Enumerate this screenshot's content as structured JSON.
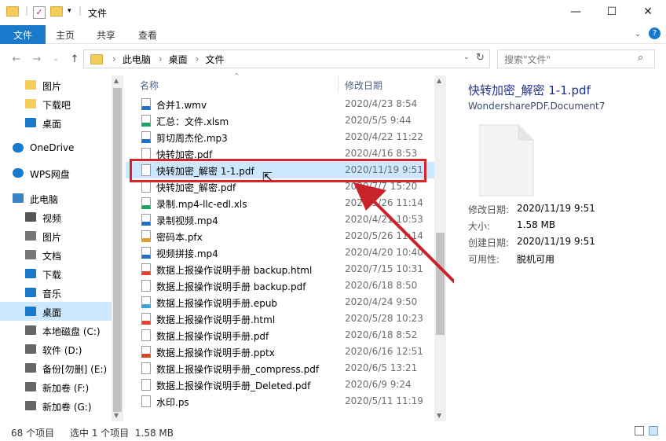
{
  "window": {
    "title": "文件",
    "minimize": "—",
    "maximize": "☐",
    "close": "✕",
    "help": "?"
  },
  "ribbon": {
    "tabs": [
      "文件",
      "主页",
      "共享",
      "查看"
    ]
  },
  "address": {
    "segments": [
      "此电脑",
      "桌面",
      "文件"
    ],
    "sep": "›"
  },
  "search": {
    "placeholder": "搜索\"文件\""
  },
  "nav": {
    "items": [
      {
        "label": "图片",
        "icon": "folder-icon"
      },
      {
        "label": "下载吧",
        "icon": "folder-icon"
      },
      {
        "label": "桌面",
        "icon": "desktop-icon"
      },
      {
        "label": "OneDrive",
        "icon": "cloud-icon"
      },
      {
        "label": "WPS网盘",
        "icon": "cloud-icon"
      },
      {
        "label": "此电脑",
        "icon": "computer-icon"
      },
      {
        "label": "视频",
        "icon": "video-folder-icon"
      },
      {
        "label": "图片",
        "icon": "pictures-folder-icon"
      },
      {
        "label": "文档",
        "icon": "documents-folder-icon"
      },
      {
        "label": "下载",
        "icon": "download-icon"
      },
      {
        "label": "音乐",
        "icon": "music-icon"
      },
      {
        "label": "桌面",
        "icon": "desktop-icon"
      },
      {
        "label": "本地磁盘 (C:)",
        "icon": "drive-icon"
      },
      {
        "label": "软件 (D:)",
        "icon": "drive-icon"
      },
      {
        "label": "备份[勿删] (E:)",
        "icon": "drive-icon"
      },
      {
        "label": "新加卷 (F:)",
        "icon": "drive-icon"
      },
      {
        "label": "新加卷 (G:)",
        "icon": "drive-icon"
      }
    ]
  },
  "list": {
    "col_name": "名称",
    "col_date": "修改日期",
    "files": [
      {
        "name": "合并1.wmv",
        "date": "2020/4/23 8:54",
        "icon": "video-file-icon"
      },
      {
        "name": "汇总：文件.xlsm",
        "date": "2020/5/5 9:44",
        "icon": "excel-file-icon"
      },
      {
        "name": "剪切周杰伦.mp3",
        "date": "2020/4/22 11:22",
        "icon": "audio-file-icon"
      },
      {
        "name": "快转加密.pdf",
        "date": "2020/4/16 8:53",
        "icon": "pdf-file-icon"
      },
      {
        "name": "快转加密_解密 1-1.pdf",
        "date": "2020/11/19 9:51",
        "icon": "pdf-file-icon"
      },
      {
        "name": "快转加密_解密.pdf",
        "date": "2020/7/7 15:20",
        "icon": "pdf-file-icon"
      },
      {
        "name": "录制.mp4-llc-edl.xls",
        "date": "2020/5/26 11:14",
        "icon": "excel-file-icon"
      },
      {
        "name": "录制视频.mp4",
        "date": "2020/4/21 10:53",
        "icon": "video-file-icon"
      },
      {
        "name": "密码本.pfx",
        "date": "2020/5/26 11:14",
        "icon": "cert-file-icon"
      },
      {
        "name": "视频拼接.mp4",
        "date": "2020/4/20 10:40",
        "icon": "video-file-icon"
      },
      {
        "name": "数据上报操作说明手册 backup.html",
        "date": "2020/7/15 10:31",
        "icon": "chrome-file-icon"
      },
      {
        "name": "数据上报操作说明手册 backup.pdf",
        "date": "2020/6/18 8:50",
        "icon": "pdf-file-icon"
      },
      {
        "name": "数据上报操作说明手册.epub",
        "date": "2020/4/24 9:50",
        "icon": "epub-file-icon"
      },
      {
        "name": "数据上报操作说明手册.html",
        "date": "2020/5/28 10:23",
        "icon": "chrome-file-icon"
      },
      {
        "name": "数据上报操作说明手册.pdf",
        "date": "2020/6/18 8:52",
        "icon": "pdf-file-icon"
      },
      {
        "name": "数据上报操作说明手册.pptx",
        "date": "2020/6/16 12:51",
        "icon": "ppt-file-icon"
      },
      {
        "name": "数据上报操作说明手册_compress.pdf",
        "date": "2020/6/5 13:21",
        "icon": "pdf-file-icon"
      },
      {
        "name": "数据上报操作说明手册_Deleted.pdf",
        "date": "2020/6/9 9:24",
        "icon": "pdf-file-icon"
      },
      {
        "name": "水印.ps",
        "date": "2020/5/11 11:19",
        "icon": "generic-file-icon"
      }
    ],
    "selected_index": 4
  },
  "preview": {
    "filename": "快转加密_解密 1-1.pdf",
    "type": "WondersharePDF.Document7",
    "props": [
      {
        "label": "修改日期:",
        "value": "2020/11/19 9:51"
      },
      {
        "label": "大小:",
        "value": "1.58 MB"
      },
      {
        "label": "创建日期:",
        "value": "2020/11/19 9:51"
      },
      {
        "label": "可用性:",
        "value": "脱机可用"
      }
    ]
  },
  "status": {
    "count": "68 个项目",
    "selection": "选中 1 个项目  1.58 MB"
  },
  "colors": {
    "accent": "#1979ca",
    "selection": "#cce8ff",
    "highlight_box": "#d9232a",
    "arrow": "#c8232a"
  }
}
